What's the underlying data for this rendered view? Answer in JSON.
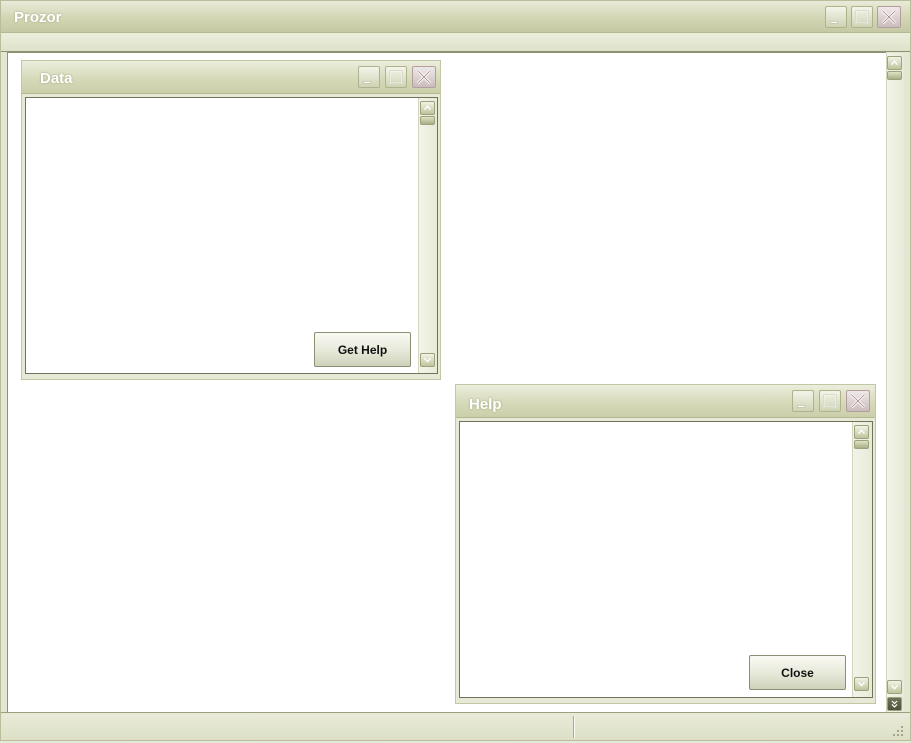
{
  "main_window": {
    "title": "Prozor",
    "controls": [
      "minimize-icon",
      "maximize-icon",
      "close-icon"
    ]
  },
  "internal_frames": {
    "data": {
      "title": "Data",
      "button_label": "Get Help"
    },
    "help": {
      "title": "Help",
      "button_label": "Close"
    }
  },
  "colors": {
    "title_bar": "#d2d6b4",
    "title_text": "#ffffff",
    "frame_bg": "#e3e6d0",
    "close_tint": "#cbbdbd",
    "scroll_button": "#bfc49c"
  }
}
